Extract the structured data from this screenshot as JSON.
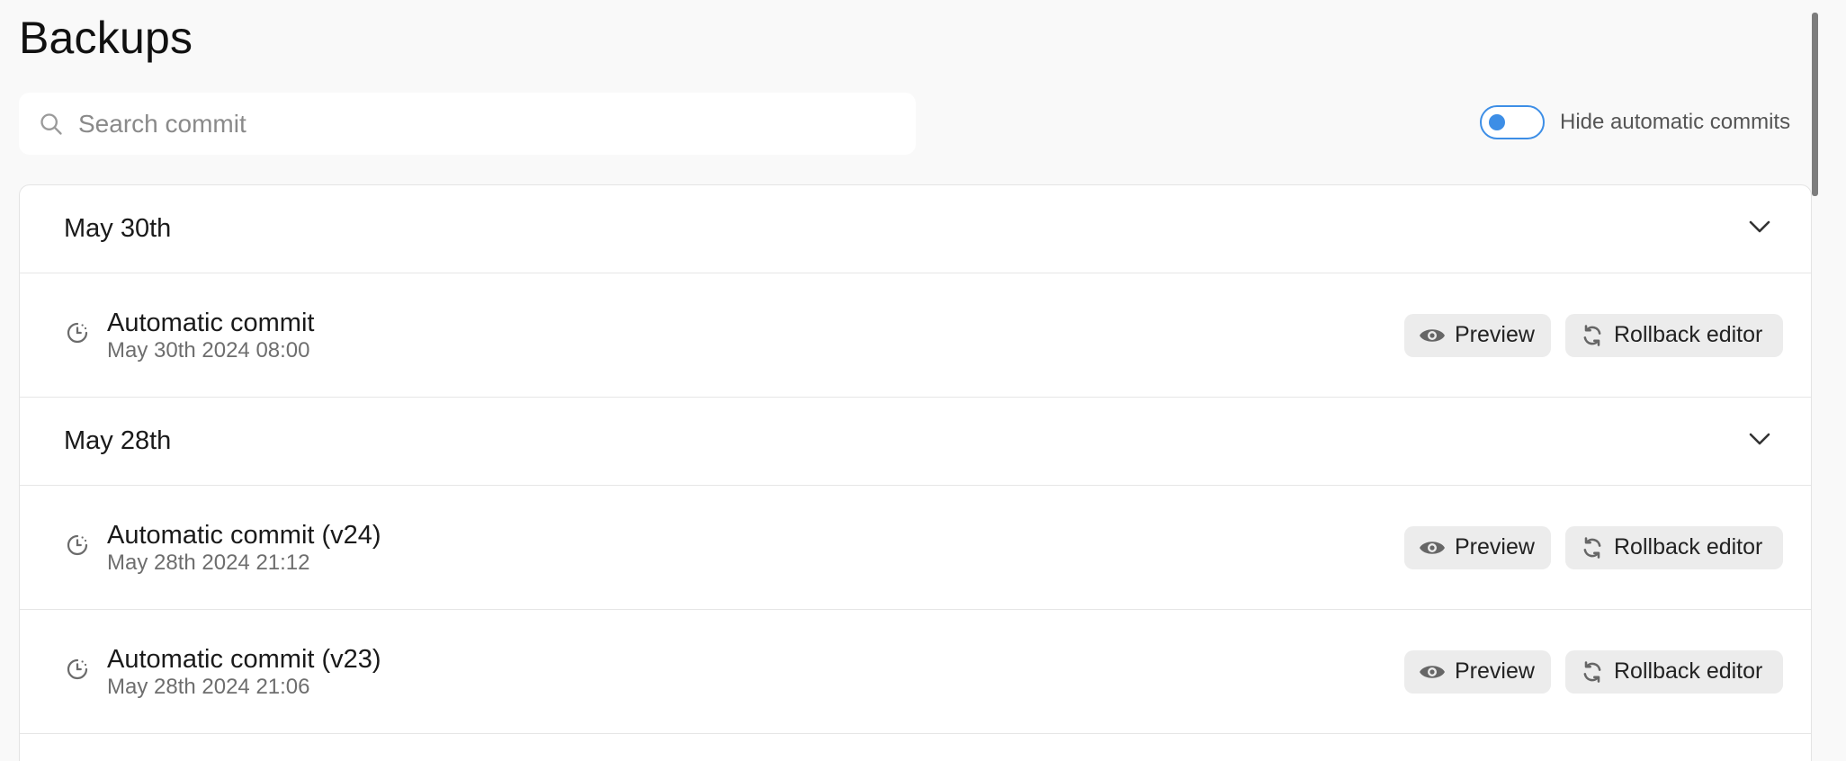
{
  "page": {
    "title": "Backups"
  },
  "search": {
    "placeholder": "Search commit",
    "value": ""
  },
  "filter": {
    "toggle_label": "Hide automatic commits",
    "toggle_on": false,
    "accent": "#3d8ee6"
  },
  "groups": [
    {
      "label": "May 30th",
      "commits": [
        {
          "title": "Automatic commit",
          "date": "May 30th 2024 08:00"
        }
      ]
    },
    {
      "label": "May 28th",
      "commits": [
        {
          "title": "Automatic commit (v24)",
          "date": "May 28th 2024 21:12"
        },
        {
          "title": "Automatic commit (v23)",
          "date": "May 28th 2024 21:06"
        }
      ]
    }
  ],
  "actions": {
    "preview_label": "Preview",
    "rollback_label": "Rollback editor"
  },
  "icons": {
    "search": "search-icon",
    "chevron": "chevron-down-icon",
    "commit": "history-clock-icon",
    "preview": "eye-icon",
    "rollback": "refresh-icon"
  }
}
